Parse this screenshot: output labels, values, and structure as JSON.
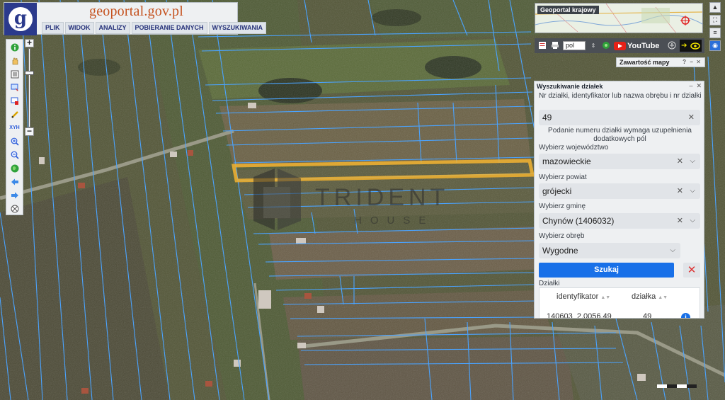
{
  "header": {
    "logo_letter": "g",
    "brand": "geoportal.gov.pl",
    "menu": [
      "PLIK",
      "WIDOK",
      "ANALIZY",
      "POBIERANIE DANYCH",
      "WYSZUKIWANIA"
    ]
  },
  "overview": {
    "title": "Geoportal krajowy"
  },
  "topbar": {
    "language": "pol",
    "youtube": "YouTube"
  },
  "contents_tab": {
    "title": "Zawartość mapy"
  },
  "watermark": {
    "line1": "TRIDENT",
    "line2": "HOUSE"
  },
  "search_panel": {
    "title": "Wyszukiwanie działek",
    "nr_label": "Nr działki, identyfikator lub nazwa obrębu i nr działki",
    "nr_value": "49",
    "note": "Podanie numeru działki wymaga uzupełnienia dodatkowych pól",
    "voivodeship_label": "Wybierz województwo",
    "voivodeship_value": "mazowieckie",
    "county_label": "Wybierz powiat",
    "county_value": "grójecki",
    "commune_label": "Wybierz gminę",
    "commune_value": "Chynów (1406032)",
    "precinct_label": "Wybierz obręb",
    "precinct_value": "Wygodne",
    "search_button": "Szukaj",
    "results_label": "Działki",
    "results": {
      "columns": [
        "identyfikator",
        "działka"
      ],
      "rows": [
        {
          "identyfikator": "140603_2.0056.49",
          "dzialka": "49"
        }
      ]
    }
  },
  "colors": {
    "parcel_lines": "#4aa3ff",
    "highlight": "#f2b330",
    "brand": "#c5521f",
    "logo_bg": "#2b3a8c",
    "search_button": "#1870e8"
  },
  "icons": [
    "info-icon",
    "pan-hand-icon",
    "layers-icon",
    "select-icon",
    "delete-icon",
    "measure-icon",
    "xy-icon",
    "zoom-in-icon",
    "zoom-out-icon",
    "globe-icon",
    "back-arrow-icon",
    "forward-arrow-icon",
    "full-extent-icon",
    "print-icon",
    "eye-icon"
  ]
}
